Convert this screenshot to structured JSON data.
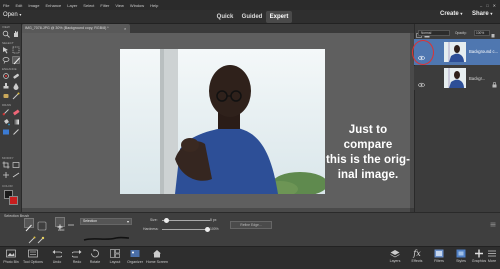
{
  "menu": {
    "items": [
      "File",
      "Edit",
      "Image",
      "Enhance",
      "Layer",
      "Select",
      "Filter",
      "View",
      "Window",
      "Help"
    ],
    "window_controls": [
      "–",
      "□",
      "✕"
    ]
  },
  "modebar": {
    "open_label": "Open",
    "modes": [
      "Quick",
      "Guided",
      "Expert"
    ],
    "active_mode": "Expert",
    "create_label": "Create",
    "share_label": "Share"
  },
  "document": {
    "tab_label": "IMG_7078.JPG @ 30% (Background copy, RGB/8) *",
    "close": "×"
  },
  "toolbar": {
    "sections": [
      "VIEW",
      "SELECT",
      "ENHANCE",
      "DRAW",
      "MODIFY",
      "COLOR"
    ]
  },
  "canvas": {
    "overlay_text": [
      "Just to compare",
      "this is the orig-",
      "inal image."
    ]
  },
  "layers": {
    "blend_mode": "Normal",
    "opacity_label": "Opacity:",
    "opacity_value": "100%",
    "items": [
      {
        "name": "Background c...",
        "selected": true
      },
      {
        "name": "Backgr...",
        "selected": false
      }
    ]
  },
  "options": {
    "tool_name": "Selection Brush",
    "add_label": "Add",
    "mode_value": "Selection",
    "size_label": "Size:",
    "size_value": "8 px",
    "hardness_label": "Hardness:",
    "hardness_value": "100%",
    "size_fraction": 0.05,
    "hardness_fraction": 1.0,
    "refine_label": "Refine Edge..."
  },
  "bottom_left": [
    {
      "icon": "photo-bin-icon",
      "label": "Photo Bin"
    },
    {
      "icon": "tool-options-icon",
      "label": "Tool Options"
    },
    {
      "icon": "undo-icon",
      "label": "Undo"
    },
    {
      "icon": "redo-icon",
      "label": "Redo"
    },
    {
      "icon": "rotate-icon",
      "label": "Rotate"
    },
    {
      "icon": "layout-icon",
      "label": "Layout"
    },
    {
      "icon": "organizer-icon",
      "label": "Organizer"
    },
    {
      "icon": "home-screen-icon",
      "label": "Home Screen"
    }
  ],
  "bottom_right": [
    {
      "icon": "layers-icon",
      "label": "Layers"
    },
    {
      "icon": "effects-icon",
      "label": "Effects"
    },
    {
      "icon": "filters-icon",
      "label": "Filters"
    },
    {
      "icon": "styles-icon",
      "label": "Styles"
    },
    {
      "icon": "graphics-icon",
      "label": "Graphics"
    },
    {
      "icon": "more-icon",
      "label": "More"
    }
  ],
  "colors": {
    "foreground": "#c81e1e",
    "background": "#1a1a1a",
    "layer_selected": "#4f77b0",
    "highlight_circle": "#dd3333"
  }
}
